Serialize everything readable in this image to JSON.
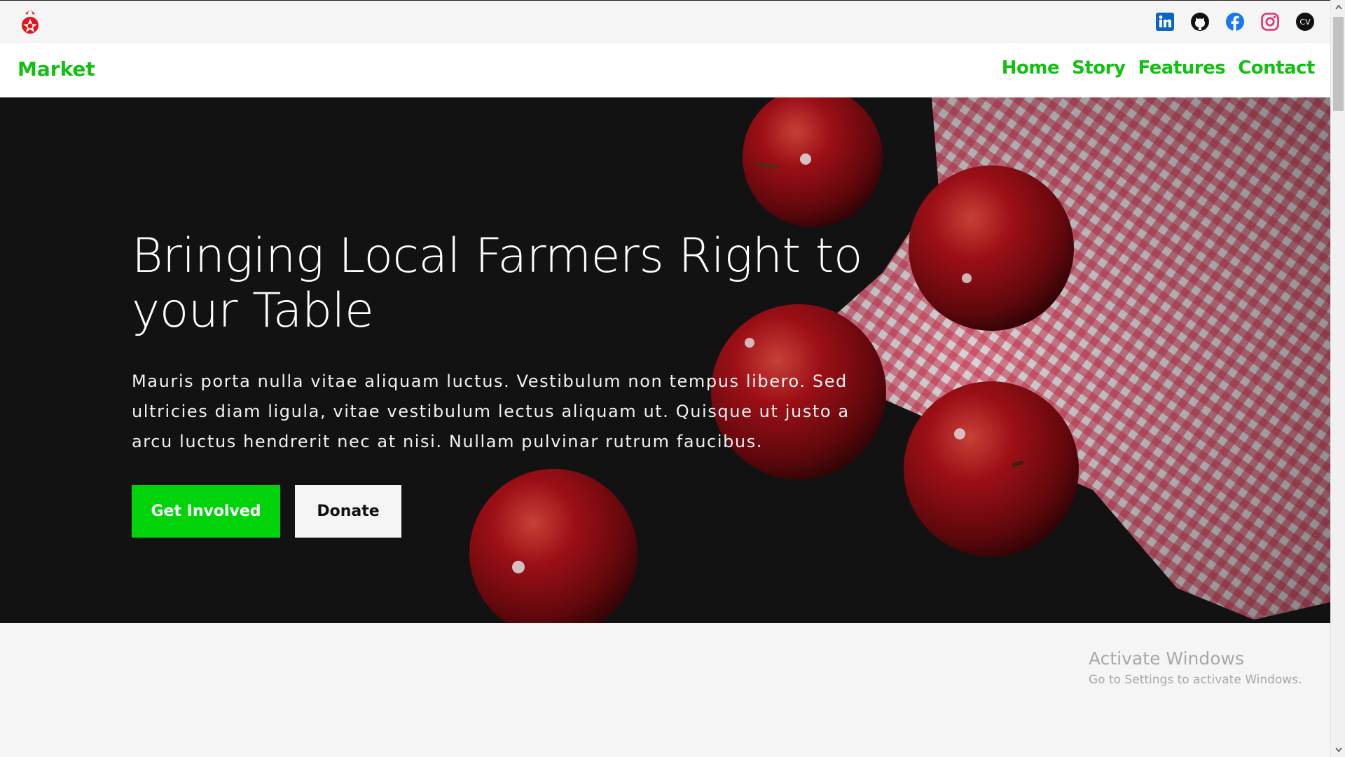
{
  "topbar": {
    "logo": "strawberry-logo-icon",
    "socials": [
      {
        "name": "linkedin-icon",
        "color": "#0a66c2"
      },
      {
        "name": "github-icon",
        "color": "#111111"
      },
      {
        "name": "facebook-icon",
        "color": "#1877f2"
      },
      {
        "name": "instagram-icon",
        "color": "#e1306c"
      },
      {
        "name": "cv-icon",
        "label": "CV",
        "color": "#111111"
      }
    ]
  },
  "navbar": {
    "brand": "Market",
    "links": [
      "Home",
      "Story",
      "Features",
      "Contact"
    ]
  },
  "hero": {
    "title": "Bringing Local Farmers Right to your Table",
    "text": "Mauris porta nulla vitae aliquam luctus. Vestibulum non tempus libero. Sed ultricies diam ligula, vitae vestibulum lectus aliquam ut. Quisque ut justo a arcu luctus hendrerit nec at nisi. Nullam pulvinar rutrum faucibus.",
    "primary_button": "Get Involved",
    "secondary_button": "Donate",
    "image": "red-apples-on-checkered-cloth"
  },
  "watermark": {
    "title": "Activate Windows",
    "subtitle": "Go to Settings to activate Windows."
  },
  "colors": {
    "accent": "#11c011",
    "button_primary": "#00d30a",
    "hero_bg": "#161616"
  }
}
